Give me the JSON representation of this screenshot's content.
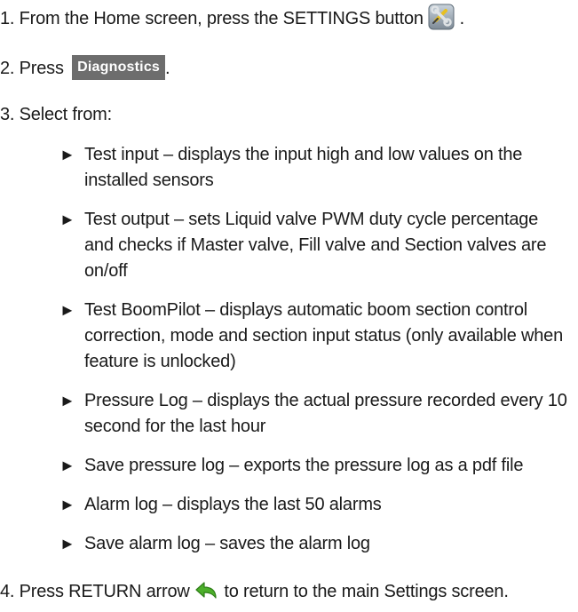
{
  "steps": {
    "step1": {
      "before": "1. From the Home screen, press the SETTINGS button",
      "after": ".",
      "icon": "settings-wrench-screwdriver-icon"
    },
    "step2": {
      "before": "2. Press",
      "button_label": "Diagnostics",
      "after": "."
    },
    "step3": {
      "text": "3. Select from:"
    },
    "step4": {
      "before": "4. Press RETURN arrow",
      "after": "to return to the main Settings screen.",
      "icon": "return-arrow-icon"
    }
  },
  "options": [
    "Test input – displays the input high and low values on the installed sensors",
    "Test output – sets Liquid valve PWM duty cycle percentage and checks if Master valve, Fill valve and Section valves are on/off",
    "Test BoomPilot – displays automatic boom section control correction, mode and section input status (only available when feature is unlocked)",
    "Pressure Log – displays the actual pressure recorded every 10 second for the last hour",
    "Save pressure log – exports the pressure log as a pdf file",
    "Alarm log – displays the last 50 alarms",
    "Save alarm log – saves the alarm log"
  ],
  "bullet_glyph": "►",
  "colors": {
    "text": "#1a1a1a",
    "button_bg": "#6d6d6d",
    "button_text": "#ffffff",
    "return_arrow": "#4caf2a"
  }
}
